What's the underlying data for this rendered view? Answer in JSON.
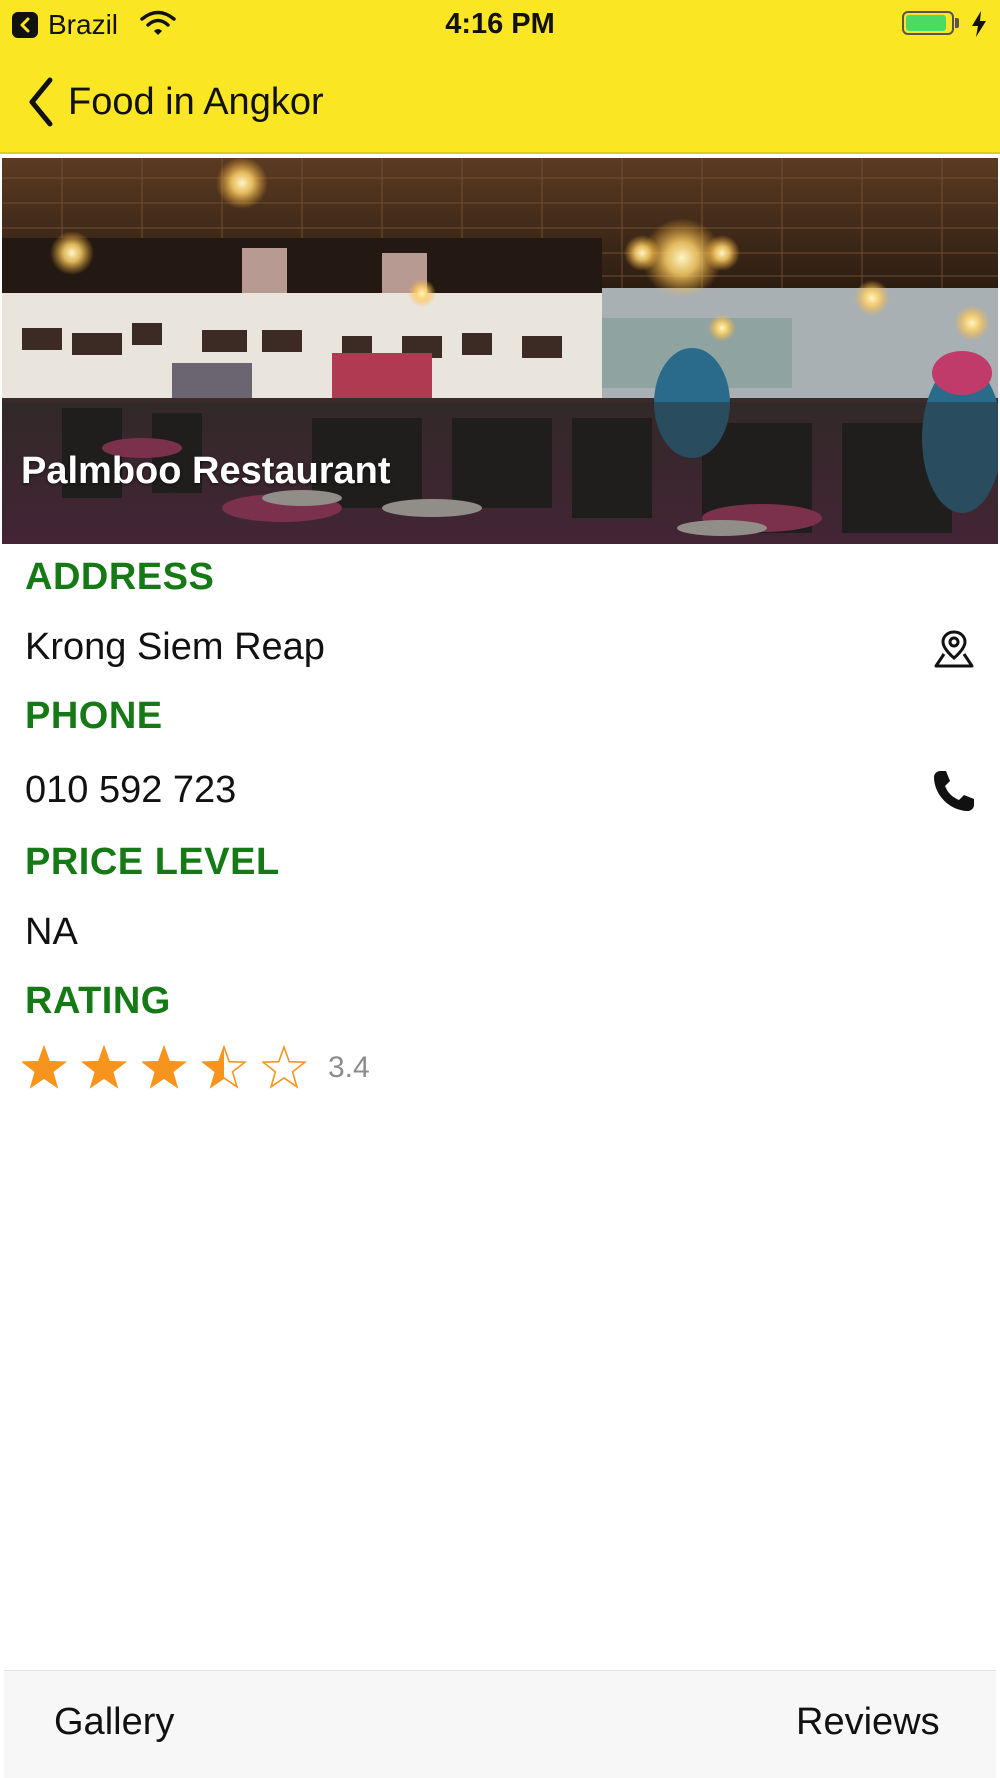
{
  "status_bar": {
    "back_app": "Brazil",
    "time": "4:16 PM",
    "battery_level": 0.9,
    "icons": [
      "back-app-icon",
      "wifi-icon",
      "battery-icon",
      "charging-bolt-icon"
    ]
  },
  "nav": {
    "back_label": "Food in Angkor",
    "back_icon": "chevron-left-icon",
    "bar_color": "#fbe623"
  },
  "place": {
    "name": "Palmboo Restaurant",
    "photo": "restaurant-interior-photo"
  },
  "details": {
    "address_label": "ADDRESS",
    "address_value": "Krong Siem Reap",
    "address_icon": "map-pin-icon",
    "phone_label": "PHONE",
    "phone_value": "010 592 723",
    "phone_icon": "phone-icon",
    "price_label": "PRICE LEVEL",
    "price_value": "NA",
    "rating_label": "RATING",
    "rating_value": "3.4",
    "rating_stars": 3.4,
    "label_color": "#157a15",
    "star_color": "#f7941d"
  },
  "toolbar": {
    "gallery_label": "Gallery",
    "reviews_label": "Reviews"
  }
}
